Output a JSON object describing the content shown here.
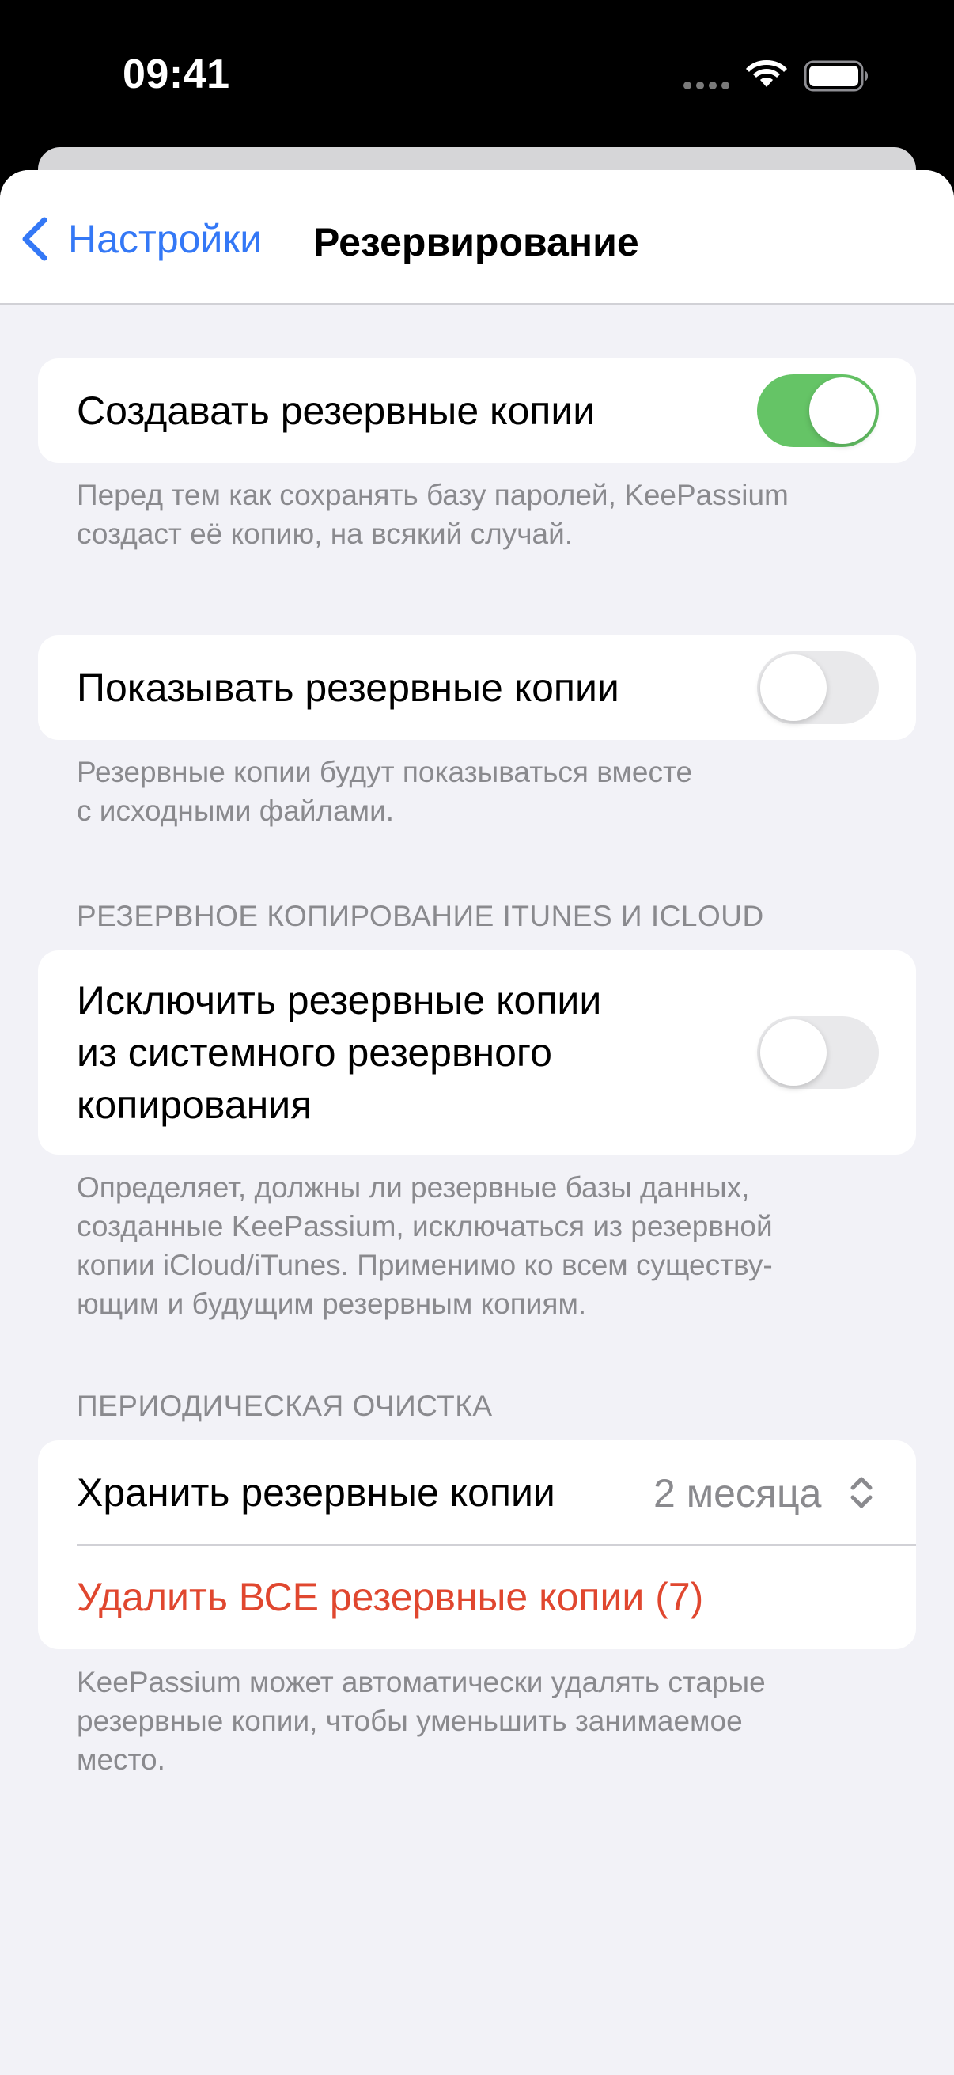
{
  "status_bar": {
    "time": "09:41",
    "icons": [
      "signal-dots-icon",
      "wifi-icon",
      "battery-icon"
    ]
  },
  "nav": {
    "back_label": "Настройки",
    "title": "Резервирование"
  },
  "sections": {
    "create_backups": {
      "label": "Создавать резервные копии",
      "toggle_on": true,
      "footer": [
        "Перед тем как сохранять базу паролей, KeePassium",
        "создаст её копию, на всякий случай."
      ]
    },
    "show_backups": {
      "label": "Показывать резервные копии",
      "toggle_on": false,
      "footer": [
        "Резервные копии будут показываться вместе",
        "с исходными файлами."
      ]
    },
    "itunes_icloud": {
      "header": "РЕЗЕРВНОЕ КОПИРОВАНИЕ ITUNES И ICLOUD",
      "label": [
        "Исключить резервные копии",
        "из системного резервного",
        "копирования"
      ],
      "toggle_on": false,
      "footer": [
        "Определяет, должны ли резервные базы данных,",
        "созданные KeePassium, исключаться из резервной",
        "копии iCloud/iTunes. Применимо ко всем существу-",
        "ющим и будущим резервным копиям."
      ]
    },
    "cleanup": {
      "header": "ПЕРИОДИЧЕСКАЯ ОЧИСТКА",
      "keep_label": "Хранить резервные копии",
      "keep_value": "2 месяца",
      "delete_label": "Удалить ВСЕ резервные копии (7)",
      "footer": [
        "KeePassium может автоматически удалять старые",
        "резервные копии, чтобы уменьшить занимаемое",
        "место."
      ]
    }
  },
  "colors": {
    "accent": "#3478f6",
    "toggle_on": "#65c466",
    "destructive": "#e0472f",
    "secondary_text": "#8a8a8e",
    "grouped_background": "#f2f2f7"
  }
}
